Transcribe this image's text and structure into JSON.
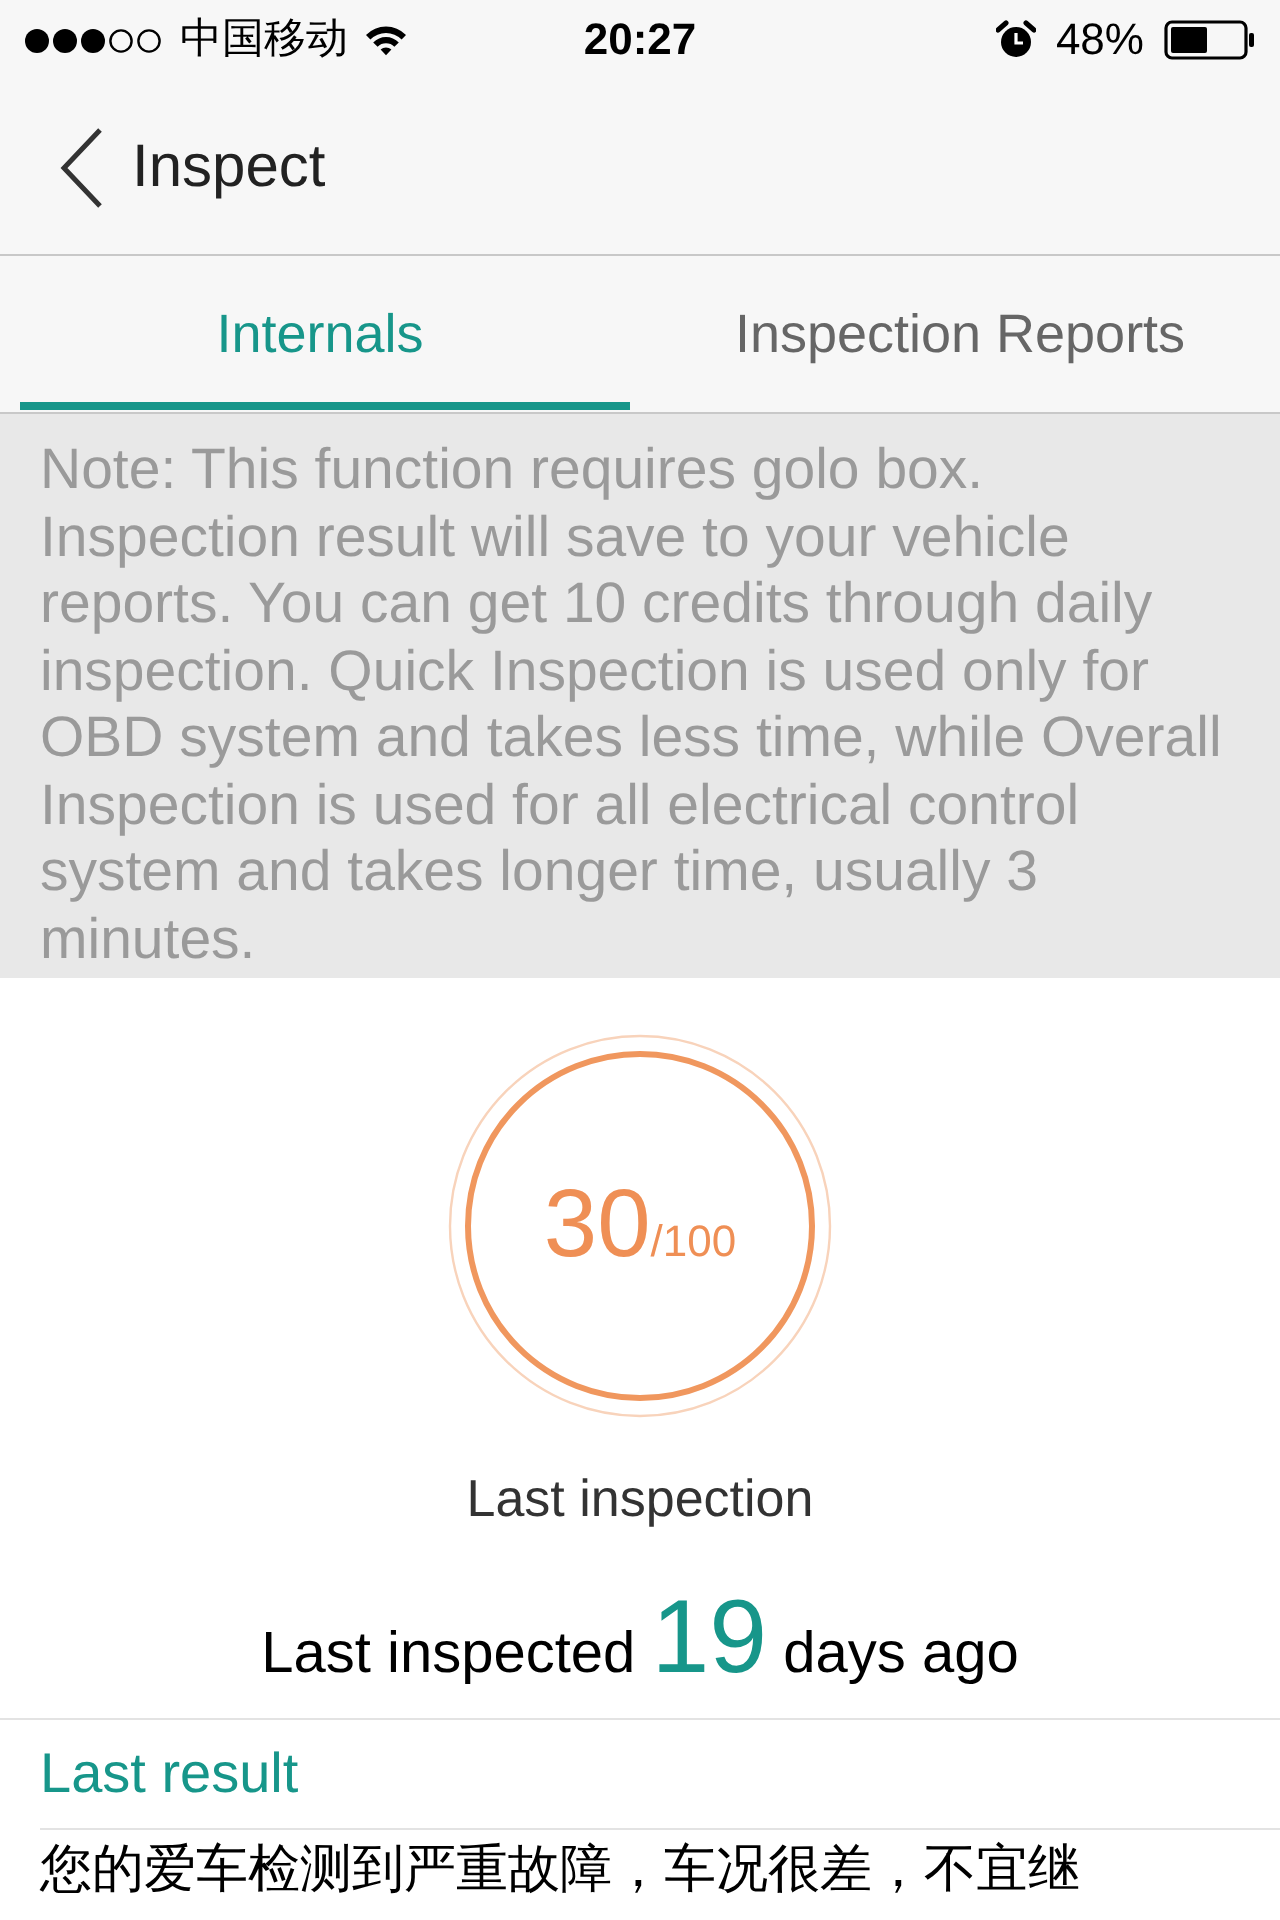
{
  "status_bar": {
    "carrier": "中国移动",
    "time": "20:27",
    "battery": "48%"
  },
  "nav": {
    "title": "Inspect"
  },
  "tabs": [
    {
      "label": "Internals",
      "selected": true
    },
    {
      "label": "Inspection Reports",
      "selected": false
    }
  ],
  "note": "Note: This function requires golo box. Inspection result will save to your vehicle reports. You can get 10 credits through daily inspection. Quick Inspection is used only for OBD system and takes less time, while Overall Inspection is used for all electrical control system and takes longer time, usually 3 minutes.",
  "score": {
    "value": "30",
    "max": "/100",
    "caption": "Last inspection"
  },
  "last_inspected": {
    "prefix": "Last inspected",
    "days": "19",
    "suffix": "days ago"
  },
  "last_result": {
    "title": "Last result",
    "text": "您的爱车检测到严重故障，车况很差，不宜继"
  }
}
